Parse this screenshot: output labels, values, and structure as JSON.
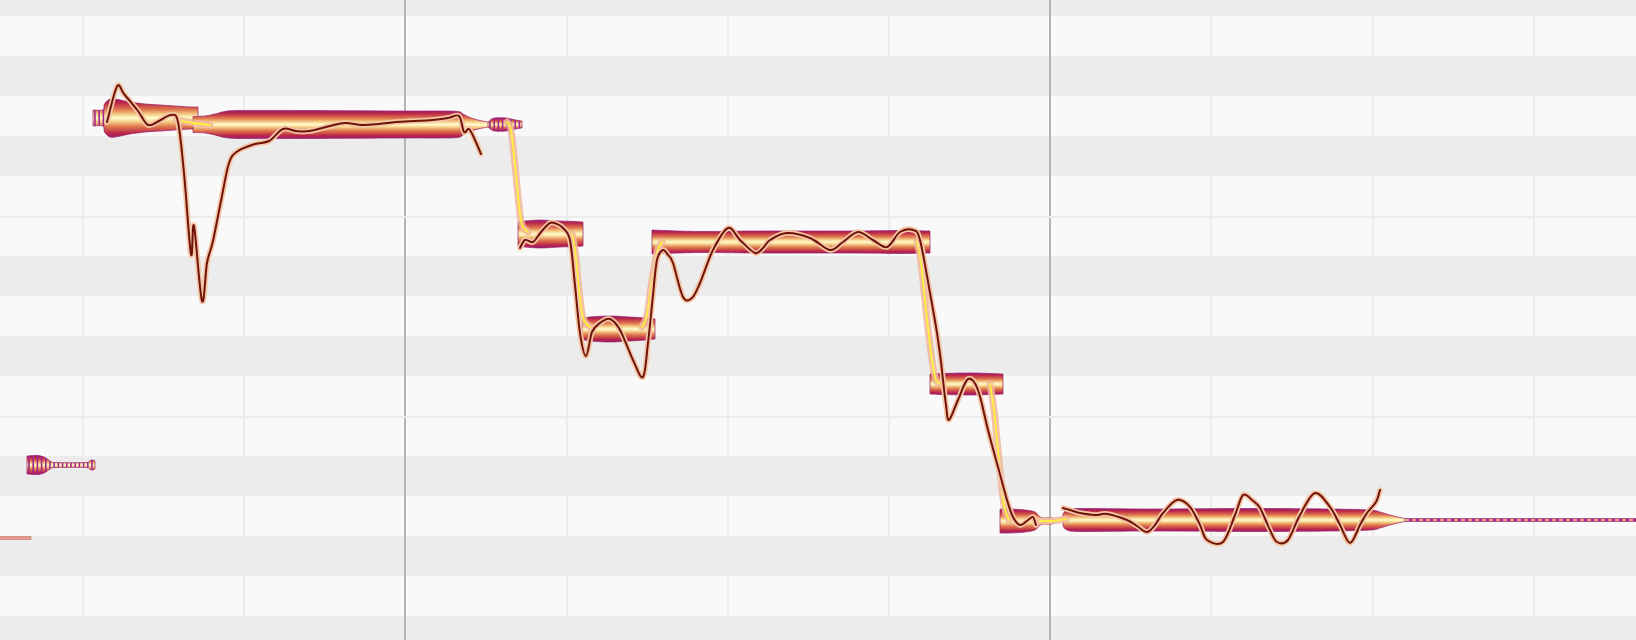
{
  "pitch_editor": {
    "lanes": [
      {
        "kind": "black"
      },
      {
        "kind": "white"
      },
      {
        "kind": "black"
      },
      {
        "kind": "white"
      },
      {
        "kind": "black"
      },
      {
        "kind": "white"
      },
      {
        "kind": "white"
      },
      {
        "kind": "black"
      },
      {
        "kind": "white"
      },
      {
        "kind": "black"
      },
      {
        "kind": "white"
      },
      {
        "kind": "white"
      },
      {
        "kind": "black"
      },
      {
        "kind": "white"
      },
      {
        "kind": "black"
      },
      {
        "kind": "white"
      },
      {
        "kind": "black"
      }
    ],
    "grid_lines": [
      {
        "kind": "beat"
      },
      {
        "kind": "beat"
      },
      {
        "kind": "bar"
      },
      {
        "kind": "beat"
      },
      {
        "kind": "beat"
      },
      {
        "kind": "beat"
      },
      {
        "kind": "bar"
      },
      {
        "kind": "beat"
      },
      {
        "kind": "beat"
      },
      {
        "kind": "beat"
      }
    ],
    "notes": [
      {
        "kind": "stub"
      },
      {
        "kind": "noise"
      },
      {
        "kind": "blob"
      },
      {
        "kind": "blob"
      },
      {
        "kind": "noise"
      },
      {
        "kind": "blob"
      },
      {
        "kind": "blob"
      },
      {
        "kind": "blob"
      },
      {
        "kind": "blob"
      },
      {
        "kind": "blob"
      },
      {
        "kind": "blob"
      }
    ]
  }
}
